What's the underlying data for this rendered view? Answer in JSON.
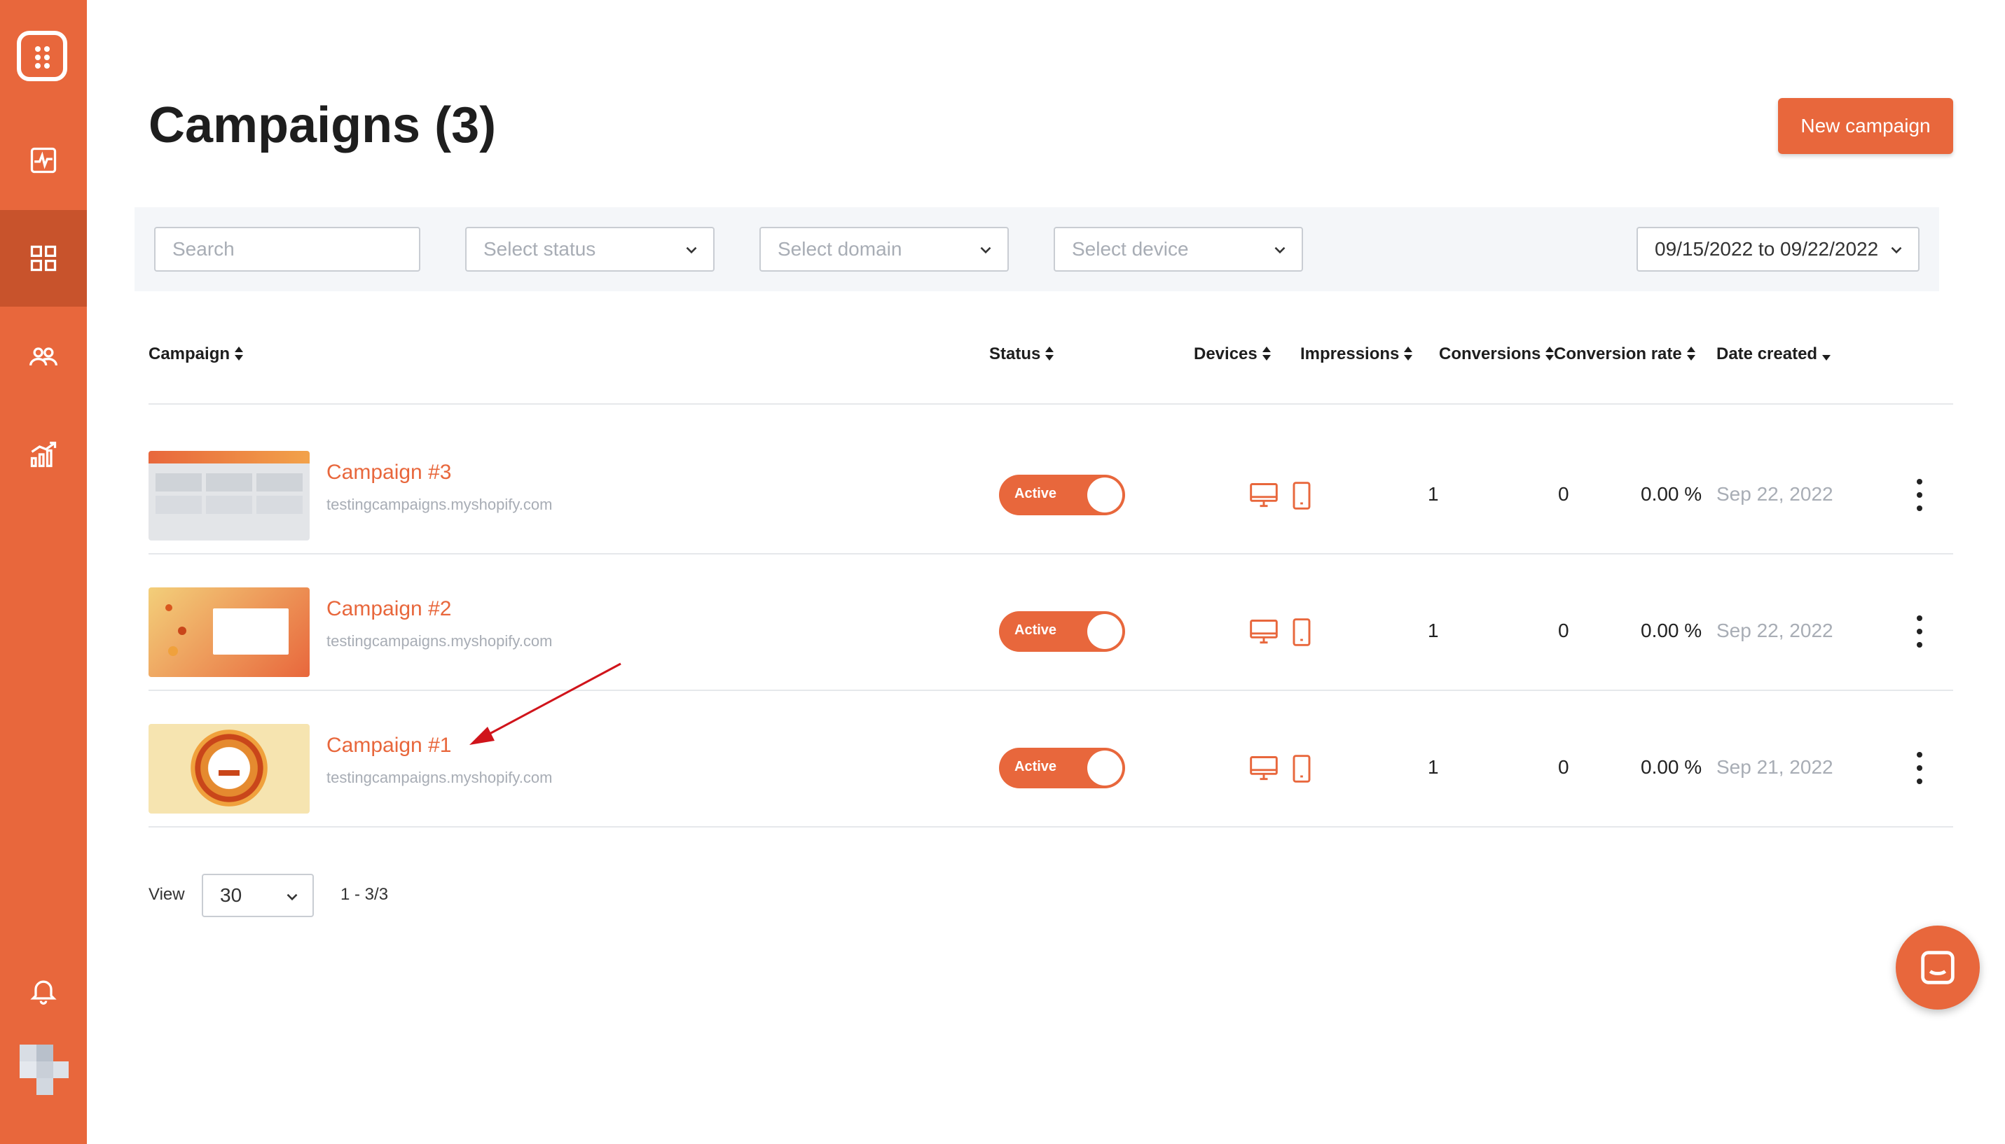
{
  "sidebar": {
    "items": [
      "logo",
      "activity",
      "campaigns",
      "audience",
      "analytics",
      "notifications",
      "avatar"
    ],
    "active": "campaigns"
  },
  "header": {
    "title": "Campaigns (3)",
    "new_button": "New campaign"
  },
  "filters": {
    "search_placeholder": "Search",
    "status_placeholder": "Select status",
    "domain_placeholder": "Select domain",
    "device_placeholder": "Select device",
    "date_range": "09/15/2022 to 09/22/2022"
  },
  "table": {
    "columns": [
      "Campaign",
      "Status",
      "Devices",
      "Impressions",
      "Conversions",
      "Conversion rate",
      "Date created"
    ],
    "rows": [
      {
        "name": "Campaign #3",
        "domain": "testingcampaigns.myshopify.com",
        "status": "Active",
        "impressions": "1",
        "conversions": "0",
        "rate": "0.00 %",
        "date": "Sep 22, 2022"
      },
      {
        "name": "Campaign #2",
        "domain": "testingcampaigns.myshopify.com",
        "status": "Active",
        "impressions": "1",
        "conversions": "0",
        "rate": "0.00 %",
        "date": "Sep 22, 2022"
      },
      {
        "name": "Campaign #1",
        "domain": "testingcampaigns.myshopify.com",
        "status": "Active",
        "impressions": "1",
        "conversions": "0",
        "rate": "0.00 %",
        "date": "Sep 21, 2022"
      }
    ]
  },
  "footer": {
    "view_label": "View",
    "per_page": "30",
    "range": "1 - 3/3"
  },
  "colors": {
    "accent": "#e8673c",
    "accent_dark": "#c8532c",
    "muted": "#a8adb5",
    "annotation": "#d0141b"
  }
}
